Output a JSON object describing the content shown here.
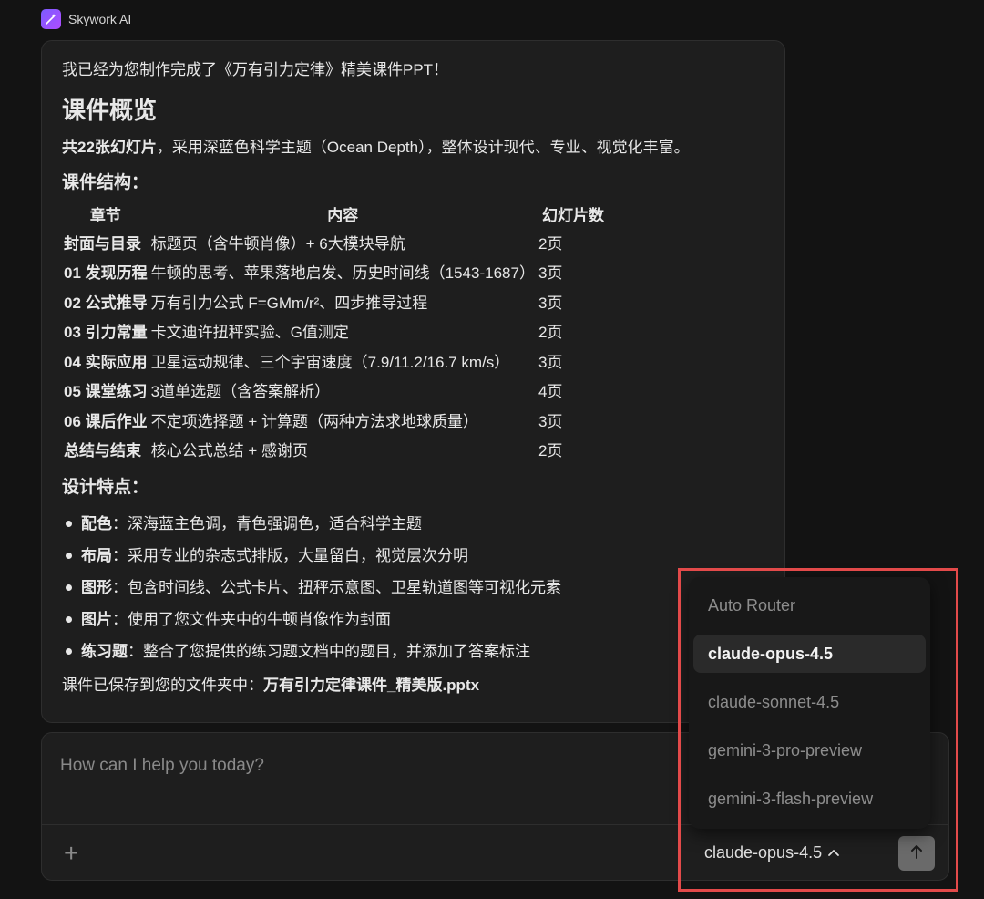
{
  "app": {
    "name": "Skywork AI"
  },
  "message": {
    "intro": "我已经为您制作完成了《万有引力定律》精美课件PPT！",
    "overview_title": "课件概览",
    "summary_bold": "共22张幻灯片",
    "summary_rest": "，采用深蓝色科学主题（Ocean Depth），整体设计现代、专业、视觉化丰富。",
    "structure_title": "课件结构：",
    "table": {
      "headers": [
        "章节",
        "内容",
        "幻灯片数"
      ],
      "rows": [
        {
          "chapter": "封面与目录",
          "content": "标题页（含牛顿肖像）+ 6大模块导航",
          "count": "2页"
        },
        {
          "chapter": "01 发现历程",
          "content": "牛顿的思考、苹果落地启发、历史时间线（1543-1687）",
          "count": "3页"
        },
        {
          "chapter": "02 公式推导",
          "content": "万有引力公式 F=GMm/r²、四步推导过程",
          "count": "3页"
        },
        {
          "chapter": "03 引力常量",
          "content": "卡文迪许扭秤实验、G值测定",
          "count": "2页"
        },
        {
          "chapter": "04 实际应用",
          "content": "卫星运动规律、三个宇宙速度（7.9/11.2/16.7 km/s）",
          "count": "3页"
        },
        {
          "chapter": "05 课堂练习",
          "content": "3道单选题（含答案解析）",
          "count": "4页"
        },
        {
          "chapter": "06 课后作业",
          "content": "不定项选择题 + 计算题（两种方法求地球质量）",
          "count": "3页"
        },
        {
          "chapter": "总结与结束",
          "content": "核心公式总结 + 感谢页",
          "count": "2页"
        }
      ]
    },
    "features_title": "设计特点：",
    "features": [
      {
        "label": "配色",
        "text": "：深海蓝主色调，青色强调色，适合科学主题"
      },
      {
        "label": "布局",
        "text": "：采用专业的杂志式排版，大量留白，视觉层次分明"
      },
      {
        "label": "图形",
        "text": "：包含时间线、公式卡片、扭秤示意图、卫星轨道图等可视化元素"
      },
      {
        "label": "图片",
        "text": "：使用了您文件夹中的牛顿肖像作为封面"
      },
      {
        "label": "练习题",
        "text": "：整合了您提供的练习题文档中的题目，并添加了答案标注"
      }
    ],
    "saved_prefix": "课件已保存到您的文件夹中：",
    "saved_file": "万有引力定律课件_精美版.pptx"
  },
  "composer": {
    "placeholder": "How can I help you today?",
    "selected_model": "claude-opus-4.5"
  },
  "model_dropdown": {
    "options": [
      "Auto Router",
      "claude-opus-4.5",
      "claude-sonnet-4.5",
      "gemini-3-pro-preview",
      "gemini-3-flash-preview"
    ],
    "selected": "claude-opus-4.5"
  },
  "colors": {
    "background": "#131313",
    "card": "#1e1e1e",
    "highlight": "#e34a4a",
    "logo_accent": "#7b5cff"
  }
}
